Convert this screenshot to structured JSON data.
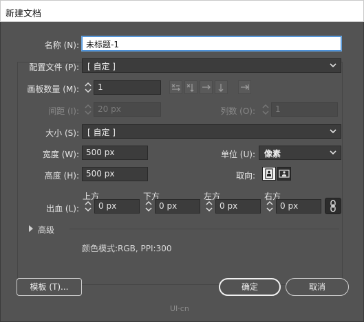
{
  "window": {
    "title": "新建文档"
  },
  "form": {
    "name_label": "名称 (N):",
    "name_value": "未标题-1",
    "profile_label": "配置文件 (P):",
    "profile_value": "[ 自定 ]",
    "artboards_label": "画板数量 (M):",
    "artboards_value": "1",
    "spacing_label": "间距 (I):",
    "spacing_value": "20 px",
    "columns_label": "列数 (O):",
    "columns_value": "1",
    "size_label": "大小 (S):",
    "size_value": "[ 自定 ]",
    "width_label": "宽度 (W):",
    "width_value": "500 px",
    "units_label": "单位 (U):",
    "units_value": "像素",
    "height_label": "高度 (H):",
    "height_value": "500 px",
    "orientation_label": "取向:",
    "bleed_label": "出血 (L):",
    "bleed_top_label": "上方",
    "bleed_top_value": "0 px",
    "bleed_bottom_label": "下方",
    "bleed_bottom_value": "0 px",
    "bleed_left_label": "左方",
    "bleed_left_value": "0 px",
    "bleed_right_label": "右方",
    "bleed_right_value": "0 px",
    "advanced_label": "高级",
    "color_mode_text": "颜色模式:RGB, PPI:300"
  },
  "buttons": {
    "templates": "模板 (T)...",
    "ok": "确定",
    "cancel": "取消"
  },
  "watermark": "UI·cn",
  "colors": {
    "dialog_bg": "#535353",
    "field_bg": "#3c3c3c",
    "focus_blue": "#4a90d9"
  }
}
